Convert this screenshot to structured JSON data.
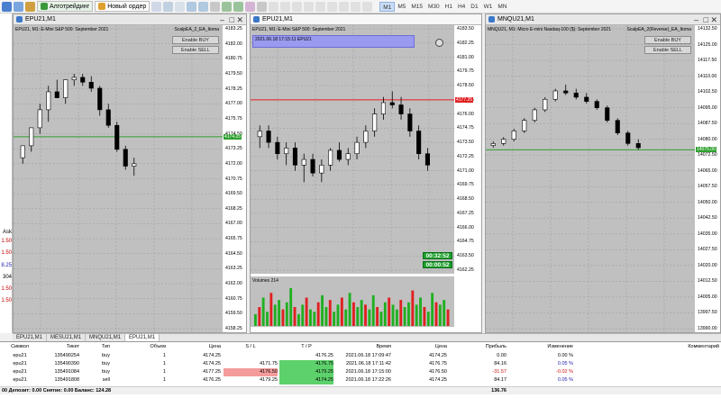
{
  "toolbar": {
    "algo_label": "Алготрейдинг",
    "new_order_label": "Новый ордер",
    "timeframes": [
      "M1",
      "M5",
      "M15",
      "M30",
      "H1",
      "H4",
      "D1",
      "W1",
      "MN"
    ],
    "active_timeframe": "M1"
  },
  "sidebar": {
    "labels": [
      "Ask",
      "1.50",
      "1.50",
      "8.25",
      "304",
      "1.50",
      "1.50"
    ]
  },
  "charts": [
    {
      "window_title": "EPU21,M1",
      "symbol_text": "EPU21, M1: E-Mini S&P 500: September 2021",
      "ea_label": "ScalpEA_2_EA_Itoma",
      "ea_buttons": [
        "Enable BUY",
        "Enable SELL"
      ],
      "price_labels": [
        "4183.25",
        "4182.00",
        "4180.75",
        "4179.50",
        "4178.25",
        "4177.00",
        "4175.75",
        "4174.50",
        "4173.25",
        "4172.00",
        "4170.75",
        "4169.50",
        "4168.25",
        "4167.00",
        "4165.75",
        "4164.50",
        "4163.25",
        "4162.00",
        "4160.75",
        "4159.50",
        "4158.25"
      ],
      "current_price": "4174.25",
      "hline_color": "#2ea02e",
      "ohlc": [
        [
          4172.5,
          4173.5,
          4172,
          4173.5
        ],
        [
          4173.5,
          4175,
          4173,
          4175
        ],
        [
          4175,
          4177,
          4174.5,
          4176.5
        ],
        [
          4176.5,
          4178.5,
          4175.5,
          4178
        ],
        [
          4178,
          4179,
          4177.5,
          4177.5
        ],
        [
          4177.5,
          4179,
          4177,
          4179
        ],
        [
          4179,
          4179.5,
          4178.5,
          4179.2
        ],
        [
          4179.2,
          4179.5,
          4178.5,
          4178.8
        ],
        [
          4178.8,
          4179.3,
          4178,
          4178.3
        ],
        [
          4178.3,
          4178.5,
          4176,
          4176.5
        ],
        [
          4176.5,
          4177,
          4175,
          4175.2
        ],
        [
          4175.2,
          4175.5,
          4173,
          4173.2
        ],
        [
          4173.2,
          4173.5,
          4171.5,
          4171.8
        ],
        [
          4171.8,
          4172.5,
          4171,
          4172
        ]
      ]
    },
    {
      "window_title": "EPU21,M1",
      "symbol_text": "EPU21, M1: E-Mini S&P 500: September 2021",
      "info_box_text": "2021.06.18 17:15:11 EPU21",
      "price_labels": [
        "4183.50",
        "4182.25",
        "4181.00",
        "4179.75",
        "4178.50",
        "4177.25",
        "4176.00",
        "4174.75",
        "4173.50",
        "4172.25",
        "4171.00",
        "4169.75",
        "4168.50",
        "4167.25",
        "4166.00",
        "4164.75",
        "4163.50",
        "4162.25"
      ],
      "current_price": "4177.25",
      "hline_color": "#e02020",
      "timers": [
        "00:32:52",
        "00:00:52"
      ],
      "volume_label": "Volumes 214",
      "volumes": [
        5,
        8,
        12,
        6,
        14,
        9,
        11,
        7,
        10,
        16,
        8,
        5,
        9,
        12,
        7,
        6,
        10,
        13,
        8,
        11,
        6,
        9,
        12,
        7,
        14,
        10,
        8,
        11,
        9,
        7,
        13,
        8,
        6,
        10,
        12,
        9,
        7,
        11,
        8,
        10,
        15,
        9,
        12,
        8,
        6,
        14,
        10,
        9,
        11,
        7
      ],
      "ohlc": [
        [
          4174,
          4175,
          4173,
          4174.5
        ],
        [
          4174.5,
          4175,
          4173,
          4173.5
        ],
        [
          4173.5,
          4174,
          4172,
          4172.5
        ],
        [
          4172.5,
          4173.5,
          4171.5,
          4173
        ],
        [
          4173,
          4173.5,
          4171,
          4171.5
        ],
        [
          4171.5,
          4172.5,
          4170,
          4172
        ],
        [
          4172,
          4172.5,
          4170.5,
          4170.8
        ],
        [
          4170.8,
          4172,
          4170,
          4171.5
        ],
        [
          4171.5,
          4173,
          4171,
          4172.8
        ],
        [
          4172.8,
          4173.5,
          4171.8,
          4172
        ],
        [
          4172,
          4173,
          4171.5,
          4172.5
        ],
        [
          4172.5,
          4174,
          4172,
          4173.5
        ],
        [
          4173.5,
          4175,
          4173,
          4174.5
        ],
        [
          4174.5,
          4176.5,
          4174,
          4176
        ],
        [
          4176,
          4177.5,
          4175.5,
          4177
        ],
        [
          4177,
          4178,
          4176.5,
          4176.8
        ],
        [
          4176.8,
          4177.5,
          4175.5,
          4176
        ],
        [
          4176,
          4176.5,
          4174,
          4174.5
        ],
        [
          4174.5,
          4175,
          4172,
          4172.5
        ],
        [
          4172.5,
          4173,
          4171,
          4171.5
        ]
      ]
    },
    {
      "window_title": "MNQU21,M1",
      "symbol_text": "MNQU21, M1: Micro E-mini Nasdaq-100 ($): September 2021",
      "ea_label": "ScalpEA_2(Reverse)_EA_Itoma",
      "ea_buttons": [
        "Enable BUY",
        "Enable SELL"
      ],
      "price_labels": [
        "14132.50",
        "14125.00",
        "14117.50",
        "14110.00",
        "14102.50",
        "14095.00",
        "14087.50",
        "14080.00",
        "14072.50",
        "14065.00",
        "14057.50",
        "14050.00",
        "14042.50",
        "14035.00",
        "14027.50",
        "14020.00",
        "14012.50",
        "14005.00",
        "13997.50",
        "13990.00"
      ],
      "current_price": "14075.00",
      "hline_color": "#2ea02e",
      "ohlc": [
        [
          14077,
          14079,
          14076,
          14078
        ],
        [
          14078,
          14081,
          14077,
          14080
        ],
        [
          14080,
          14085,
          14079,
          14084
        ],
        [
          14084,
          14090,
          14083,
          14089
        ],
        [
          14089,
          14095,
          14088,
          14094
        ],
        [
          14094,
          14100,
          14093,
          14099
        ],
        [
          14099,
          14104,
          14098,
          14103
        ],
        [
          14103,
          14106,
          14101,
          14102
        ],
        [
          14102,
          14104,
          14099,
          14100
        ],
        [
          14100,
          14102,
          14097,
          14098
        ],
        [
          14098,
          14099,
          14094,
          14095
        ],
        [
          14095,
          14096,
          14088,
          14089
        ],
        [
          14089,
          14090,
          14082,
          14083
        ],
        [
          14083,
          14084,
          14077,
          14078
        ],
        [
          14078,
          14080,
          14075,
          14076
        ]
      ]
    }
  ],
  "tabs": [
    "EPU21,M1",
    "MESU21,M1",
    "MNQU21,M1",
    "EPU21,M1"
  ],
  "active_tab": 3,
  "trades": {
    "headers": [
      "Символ",
      "Тикет",
      "Тип",
      "Объем",
      "Цена",
      "S / L",
      "T / P",
      "Время",
      "Цена",
      "Прибыль",
      "Изменение",
      "Комментарий"
    ],
    "rows": [
      [
        "epu21",
        "135490254",
        "buy",
        "1",
        "4174.25",
        "",
        "4176.25",
        "2021.06.18 17:09:47",
        "4174.25",
        "0.00",
        "0.00 %",
        ""
      ],
      [
        "epu21",
        "135490390",
        "buy",
        "1",
        "4174.25",
        "4171.75",
        "4176.75",
        "2021.06.18 17:11:42",
        "4176.75",
        "84.16",
        "0.05 %",
        ""
      ],
      [
        "epu21",
        "135491084",
        "buy",
        "1",
        "4177.25",
        "4176.50",
        "4179.25",
        "2021.06.18 17:15:00",
        "4176.50",
        "-31.57",
        "-0.02 %",
        ""
      ],
      [
        "epu21",
        "135491808",
        "sell",
        "1",
        "4176.25",
        "4179.25",
        "4174.25",
        "2021.06.18 17:22:26",
        "4174.25",
        "84.17",
        "0.05 %",
        ""
      ]
    ],
    "total_text": "00  Депозит: 0.00  Снятие: 0.00  Баланс: 124.28",
    "total_profit": "136.76"
  }
}
